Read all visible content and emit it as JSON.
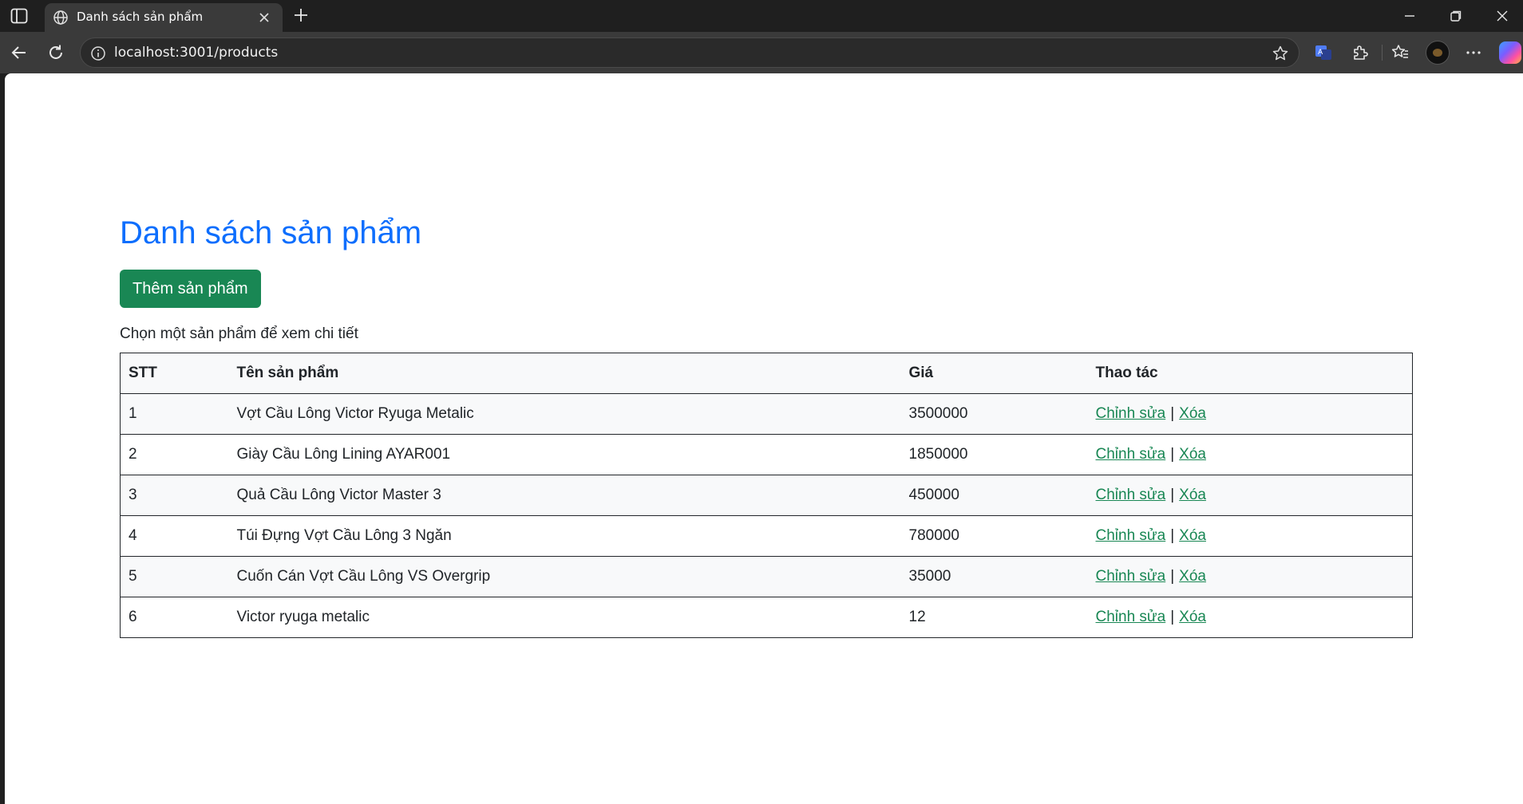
{
  "browser": {
    "tab_title": "Danh sách sản phẩm",
    "url": "localhost:3001/products"
  },
  "page": {
    "title": "Danh sách sản phẩm",
    "add_button": "Thêm sản phẩm",
    "hint": "Chọn một sản phẩm để xem chi tiết",
    "table": {
      "headers": [
        "STT",
        "Tên sản phẩm",
        "Giá",
        "Thao tác"
      ],
      "rows": [
        {
          "stt": "1",
          "name": "Vợt Cầu Lông Victor Ryuga Metalic",
          "price": "3500000"
        },
        {
          "stt": "2",
          "name": "Giày Cầu Lông Lining AYAR001",
          "price": "1850000"
        },
        {
          "stt": "3",
          "name": "Quả Cầu Lông Victor Master 3",
          "price": "450000"
        },
        {
          "stt": "4",
          "name": "Túi Đựng Vợt Cầu Lông 3 Ngăn",
          "price": "780000"
        },
        {
          "stt": "5",
          "name": "Cuốn Cán Vợt Cầu Lông VS Overgrip",
          "price": "35000"
        },
        {
          "stt": "6",
          "name": "Victor ryuga metalic",
          "price": "12"
        }
      ],
      "edit_label": "Chỉnh sửa",
      "delete_label": "Xóa",
      "action_separator": "|"
    }
  },
  "colors": {
    "title": "#0d6efd",
    "button": "#198754",
    "link": "#198754"
  }
}
